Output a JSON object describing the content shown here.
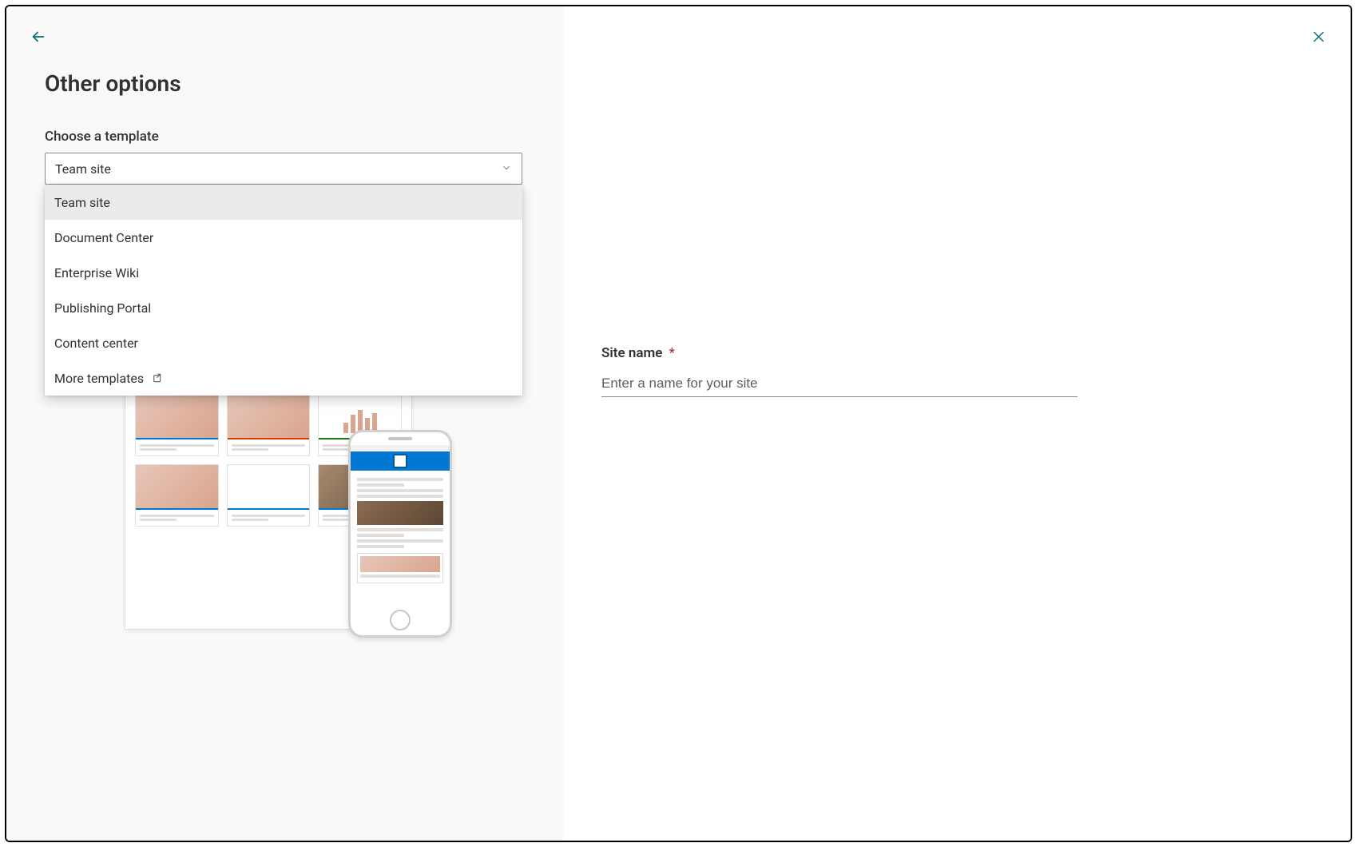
{
  "header": {
    "title": "Other options"
  },
  "template_field": {
    "label": "Choose a template",
    "selected": "Team site",
    "options": [
      "Team site",
      "Document Center",
      "Enterprise Wiki",
      "Publishing Portal",
      "Content center"
    ],
    "more_templates_label": "More templates"
  },
  "form": {
    "site_name_label": "Site name",
    "required_marker": "*",
    "site_name_placeholder": "Enter a name for your site"
  },
  "colors": {
    "accent": "#006f73",
    "primary_blue": "#0078d4"
  }
}
